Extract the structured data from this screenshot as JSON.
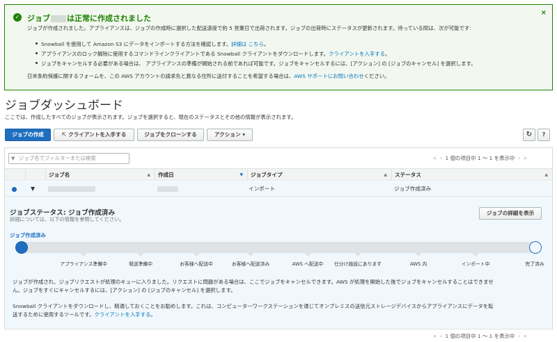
{
  "banner": {
    "title_prefix": "ジョブ",
    "title_suffix": "は正常に作成されました",
    "close_glyph": "×",
    "line1": "ジョブが作成されました。アプライアンスは、ジョブの作成時に選択した配送速度で約 5 営業日で出荷されます。ジョブの出荷時にステータスが更新されます。待っている間は、次が可能です:",
    "bullet1_text": "Snowball を使用して Amazon S3 にデータをインポートする方法を確認します。",
    "bullet1_link": "詳細は こちら",
    "bullet1_end": "。",
    "bullet2_text": "アプライアンスのロック解除に使用するコマンドラインクライアントである Snowball クライアントをダウンロードします。",
    "bullet2_link": "クライアントを入手する",
    "bullet2_end": "。",
    "bullet3": "ジョブをキャンセルする必要がある場合は、 アプライアンスの準備が開始される前であれば可能です。ジョブをキャンセルするには、[アクション] の [ジョブのキャンセル] を選択します。",
    "line2_text": "日米条約保護に関するフォームを、この AWS アカウントの請求先と異なる住所に送付することを希望する場合は、",
    "line2_link": "AWS サポートにお問い合わせ",
    "line2_end": "ください。"
  },
  "page": {
    "title": "ジョブダッシュボード",
    "description": "ここでは、作成したすべてのジョブが表示されます。ジョブを選択すると、現在のステータスとその他の情報が表示されます。"
  },
  "toolbar": {
    "create_job": "ジョブの作成",
    "get_client": "クライアントを入手する",
    "clone_job": "ジョブをクローンする",
    "actions": "アクション",
    "actions_caret": "▾",
    "refresh_glyph": "↻",
    "help_glyph": "?"
  },
  "filter": {
    "placeholder": "ジョブ名でフィルターまたは検索"
  },
  "pagination": {
    "text": "1 個の項目中 1 〜 1 を表示中"
  },
  "table": {
    "columns": [
      "ジョブ名",
      "作成日",
      "ジョブタイプ",
      "ステータス"
    ],
    "row": {
      "job_type": "インポート",
      "status": "ジョブ作成済み"
    }
  },
  "detail": {
    "title": "ジョブステータス: ジョブ作成済み",
    "subtitle": "詳細については、以下の情報を参照してください。",
    "details_button": "ジョブの詳細を表示",
    "current_status": "ジョブ作成済み",
    "progress_fraction": 0,
    "stages": [
      "アプライアンス準備中",
      "発送準備中",
      "お客様へ配送中",
      "お客様へ配送済み",
      "AWS へ配送中",
      "仕分け施設にあります",
      "AWS 内",
      "インポート中",
      "完了済み"
    ],
    "para1_line1": "ジョブが作成され、ジョブリクエストが処理のキューに入りました。リクエストに問題がある場合は、ここでジョブをキャンセルできます。AWS が処理を開始した後でジョブをキャンセルすることはできませ",
    "para1_line2": "ん。ジョブをすぐにキャンセルするには、[アクション] の [ジョブのキャンセル] を選択します。",
    "para2_line1": "Snowball クライアントをダウンロードし、精通しておくことをお勧めします。これは、コンピューターワークステーションを通じてオンプレミスの送信元ストレージデバイスからアプライアンスにデータを転",
    "para2_line2_text": "送するために使用するツールです。",
    "para2_link": "クライアントを入手する",
    "para2_end": "。"
  },
  "colors": {
    "success": "#1d8102",
    "primary": "#1f6fbf",
    "link": "#0073bb"
  }
}
